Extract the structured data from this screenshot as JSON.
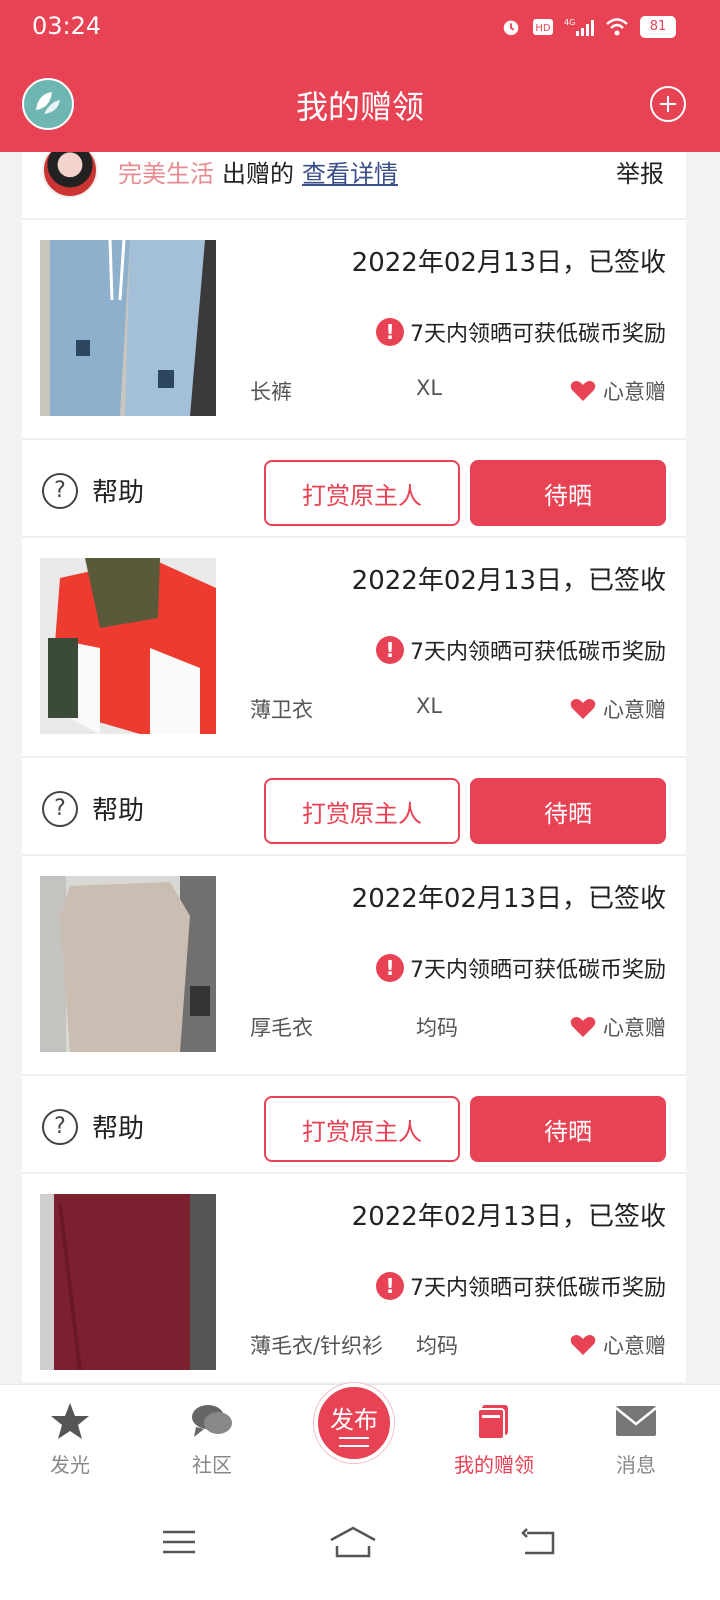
{
  "status": {
    "time": "03:24",
    "battery": "81"
  },
  "header": {
    "title": "我的赠领"
  },
  "giver": {
    "name": "完美生活",
    "verb": "出赠的",
    "link": "查看详情",
    "report": "举报"
  },
  "items": [
    {
      "date": "2022年02月13日，已签收",
      "reward": "7天内领晒可获低碳币奖励",
      "name": "长裤",
      "size": "XL",
      "type": "心意赠",
      "image": "jeans",
      "actions": {
        "help": "帮助",
        "tip": "打赏原主人",
        "show": "待晒"
      }
    },
    {
      "date": "2022年02月13日，已签收",
      "reward": "7天内领晒可获低碳币奖励",
      "name": "薄卫衣",
      "size": "XL",
      "type": "心意赠",
      "image": "hoodie",
      "actions": {
        "help": "帮助",
        "tip": "打赏原主人",
        "show": "待晒"
      }
    },
    {
      "date": "2022年02月13日，已签收",
      "reward": "7天内领晒可获低碳币奖励",
      "name": "厚毛衣",
      "size": "均码",
      "type": "心意赠",
      "image": "sweater",
      "actions": {
        "help": "帮助",
        "tip": "打赏原主人",
        "show": "待晒"
      }
    },
    {
      "date": "2022年02月13日，已签收",
      "reward": "7天内领晒可获低碳币奖励",
      "name": "薄毛衣/针织衫",
      "size": "均码",
      "type": "心意赠",
      "image": "knit"
    }
  ],
  "bottom_nav": {
    "items": [
      {
        "label": "发光",
        "icon": "star-icon"
      },
      {
        "label": "社区",
        "icon": "chat-icon"
      },
      {
        "label": "发布",
        "icon": "publish-icon"
      },
      {
        "label": "我的赠领",
        "icon": "gift-box-icon",
        "active": true
      },
      {
        "label": "消息",
        "icon": "mail-icon"
      }
    ]
  },
  "colors": {
    "accent": "#e84354",
    "giver_name": "#e88c92",
    "link": "#3a4f8a"
  }
}
